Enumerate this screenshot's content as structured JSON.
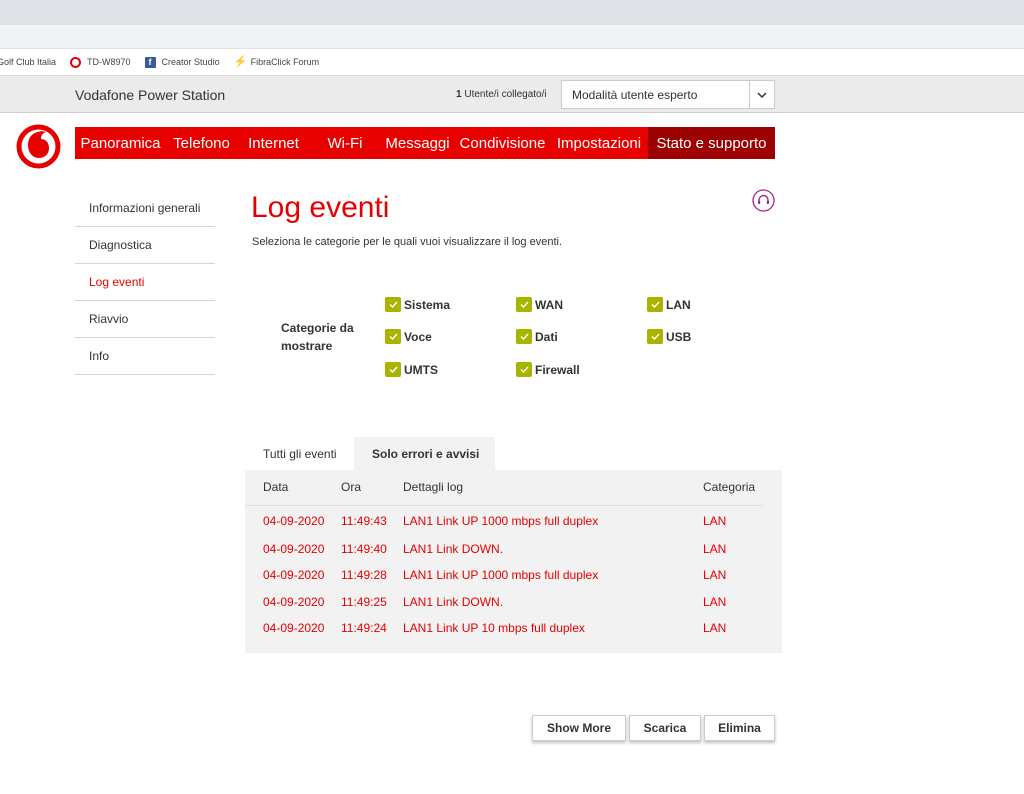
{
  "bookmarks": [
    {
      "label": "Golf Club Italia",
      "icon": "none"
    },
    {
      "label": "TD-W8970",
      "icon": "vodafone-icon"
    },
    {
      "label": "Creator Studio",
      "icon": "facebook-icon"
    },
    {
      "label": "FibraClick Forum",
      "icon": "bolt-icon"
    }
  ],
  "header": {
    "brand": "Vodafone Power Station",
    "users_count": "1",
    "users_label": "Utente/i collegato/i",
    "mode_selected": "Modalità utente esperto"
  },
  "nav": [
    {
      "label": "Panoramica"
    },
    {
      "label": "Telefono"
    },
    {
      "label": "Internet"
    },
    {
      "label": "Wi-Fi"
    },
    {
      "label": "Messaggi"
    },
    {
      "label": "Condivisione"
    },
    {
      "label": "Impostazioni"
    },
    {
      "label": "Stato e supporto"
    }
  ],
  "sidebar": [
    {
      "label": "Informazioni generali"
    },
    {
      "label": "Diagnostica"
    },
    {
      "label": "Log eventi"
    },
    {
      "label": "Riavvio"
    },
    {
      "label": "Info"
    }
  ],
  "main": {
    "title": "Log eventi",
    "subtitle": "Seleziona le categorie per le quali vuoi visualizzare il log eventi.",
    "categories_label": "Categorie da mostrare",
    "categories": [
      {
        "label": "Sistema",
        "checked": true
      },
      {
        "label": "WAN",
        "checked": true
      },
      {
        "label": "LAN",
        "checked": true
      },
      {
        "label": "Voce",
        "checked": true
      },
      {
        "label": "Dati",
        "checked": true
      },
      {
        "label": "USB",
        "checked": true
      },
      {
        "label": "UMTS",
        "checked": true
      },
      {
        "label": "Firewall",
        "checked": true
      }
    ]
  },
  "tabs": [
    {
      "label": "Tutti gli eventi"
    },
    {
      "label": "Solo errori e avvisi"
    }
  ],
  "log": {
    "headers": {
      "date": "Data",
      "time": "Ora",
      "details": "Dettagli log",
      "category": "Categoria"
    },
    "rows": [
      {
        "date": "04-09-2020",
        "time": "11:49:43",
        "details": "LAN1 Link UP 1000 mbps full duplex",
        "category": "LAN"
      },
      {
        "date": "04-09-2020",
        "time": "11:49:40",
        "details": "LAN1 Link DOWN.",
        "category": "LAN"
      },
      {
        "date": "04-09-2020",
        "time": "11:49:28",
        "details": "LAN1 Link UP 1000 mbps full duplex",
        "category": "LAN"
      },
      {
        "date": "04-09-2020",
        "time": "11:49:25",
        "details": "LAN1 Link DOWN.",
        "category": "LAN"
      },
      {
        "date": "04-09-2020",
        "time": "11:49:24",
        "details": "LAN1 Link UP 10 mbps full duplex",
        "category": "LAN"
      }
    ]
  },
  "buttons": {
    "show_more": "Show More",
    "download": "Scarica",
    "delete": "Elimina"
  },
  "colors": {
    "brand_red": "#e60000",
    "active_nav": "#9c0000",
    "checkbox": "#a8b400"
  }
}
